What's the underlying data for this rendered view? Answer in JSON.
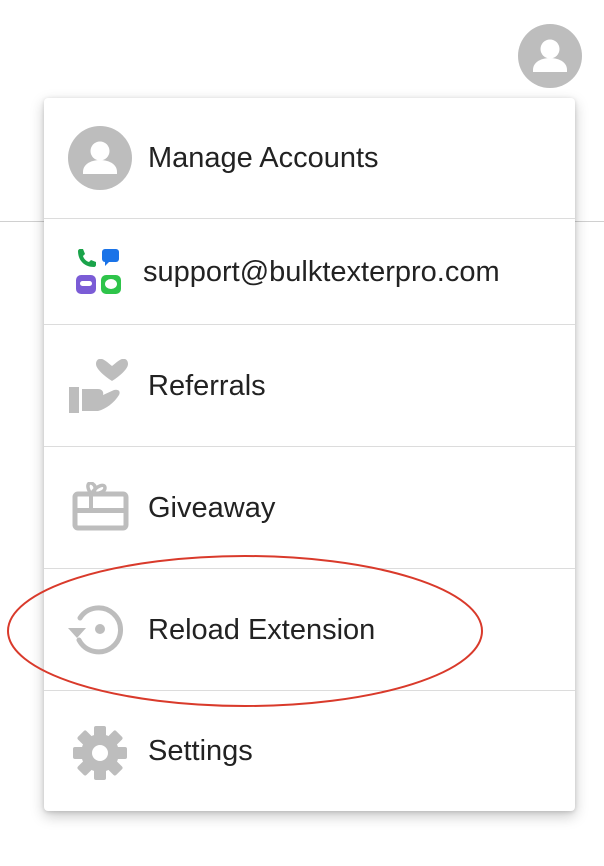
{
  "header": {
    "avatar_icon": "person-icon"
  },
  "menu": {
    "items": [
      {
        "id": "manage-accounts",
        "label": "Manage Accounts",
        "icon": "account-circle-icon"
      },
      {
        "id": "support",
        "label": "support@bulktexterpro.com",
        "icon": "bulk-texter-apps-icon"
      },
      {
        "id": "referrals",
        "label": "Referrals",
        "icon": "hand-heart-icon"
      },
      {
        "id": "giveaway",
        "label": "Giveaway",
        "icon": "gift-card-icon"
      },
      {
        "id": "reload-extension",
        "label": "Reload Extension",
        "icon": "reload-icon"
      },
      {
        "id": "settings",
        "label": "Settings",
        "icon": "gear-icon"
      }
    ]
  },
  "annotation": {
    "shape": "ellipse",
    "target": "reload-extension",
    "color": "#d93a2b"
  },
  "colors": {
    "icon_gray": "#bdbdbd",
    "divider": "#dcdcdc",
    "text": "#222222"
  }
}
